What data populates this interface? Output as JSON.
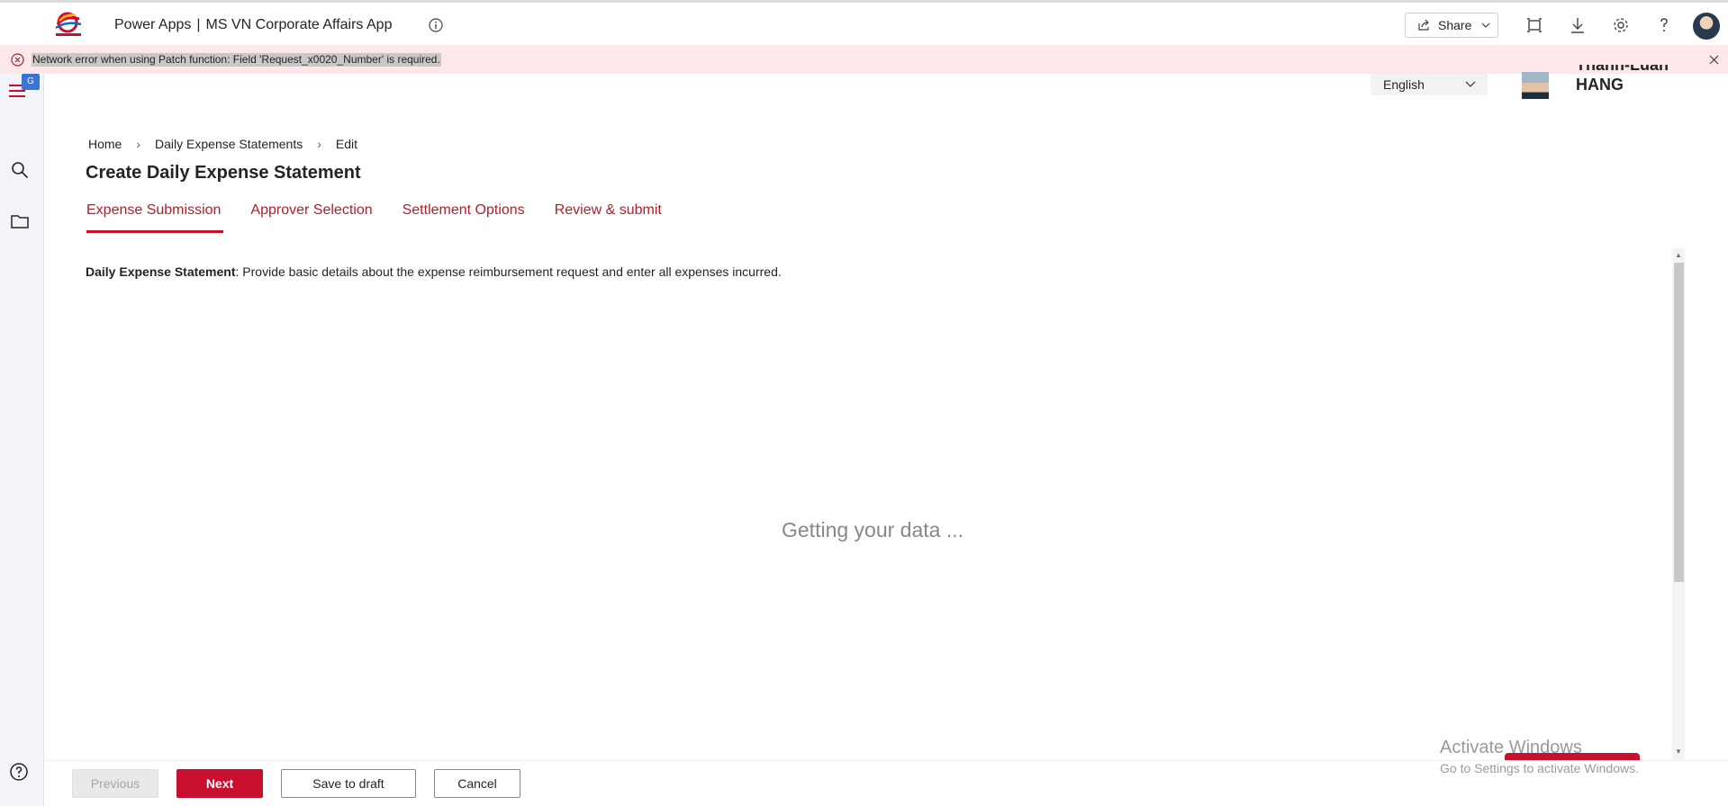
{
  "app": {
    "product": "Power Apps",
    "separator": "|",
    "name": "MS VN Corporate Affairs App",
    "share_label": "Share"
  },
  "error": {
    "message": "Network error when using Patch function: Field 'Request_x0020_Number' is required."
  },
  "nav": {
    "translate_badge": "G"
  },
  "user": {
    "language": "English",
    "name_line1": "Thanh-Luan",
    "name_line2": "HANG"
  },
  "breadcrumb": [
    "Home",
    "Daily Expense Statements",
    "Edit"
  ],
  "page": {
    "title": "Create Daily Expense Statement",
    "tabs": [
      "Expense Submission",
      "Approver Selection",
      "Settlement Options",
      "Review & submit"
    ],
    "active_tab": 0,
    "desc_bold": "Daily Expense Statement",
    "desc_rest": ": Provide basic details about the expense reimbursement request and enter all expenses incurred.",
    "loading": "Getting your data ..."
  },
  "footer": {
    "previous": "Previous",
    "next": "Next",
    "save_draft": "Save to draft",
    "cancel": "Cancel"
  },
  "watermark": {
    "line1": "Activate Windows",
    "line2": "Go to Settings to activate Windows."
  },
  "colors": {
    "accent": "#c8102e",
    "error_bg": "#fde7e9",
    "nav_bg": "#f3f4f9"
  },
  "icons": [
    "info-icon",
    "share-icon",
    "fit-screen-icon",
    "download-icon",
    "gear-icon",
    "help-icon",
    "error-icon",
    "close-icon",
    "hamburger-icon",
    "search-icon",
    "folder-icon",
    "chevron-down-icon",
    "chevron-right-icon"
  ]
}
